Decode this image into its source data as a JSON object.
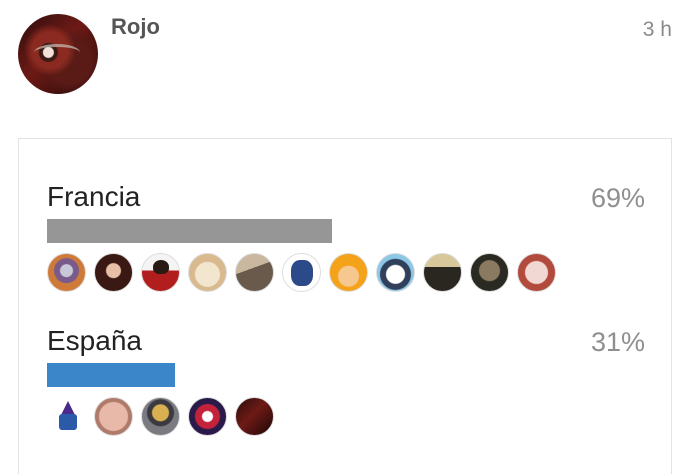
{
  "post": {
    "author": "Rojo",
    "time": "3 h"
  },
  "poll": {
    "options": [
      {
        "label": "Francia",
        "percent_label": "69%",
        "percent": 69,
        "bar_color": "#969696",
        "voter_count_shown": 11
      },
      {
        "label": "España",
        "percent_label": "31%",
        "percent": 31,
        "bar_color": "#3a86c8",
        "voter_count_shown": 5
      }
    ]
  }
}
